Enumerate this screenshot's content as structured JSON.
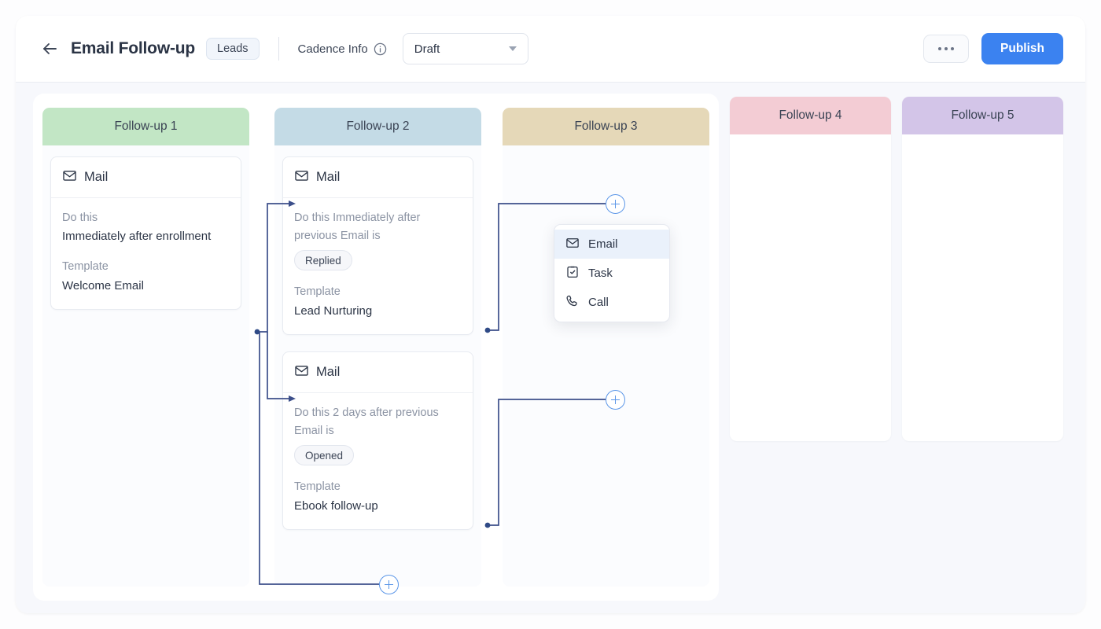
{
  "header": {
    "back_icon": "arrow-left-icon",
    "title": "Email Follow-up",
    "badge": "Leads",
    "cadence_label": "Cadence Info",
    "info_icon": "info-circle-icon",
    "status_value": "Draft",
    "status_options": [
      "Draft"
    ],
    "more_label": "...",
    "publish_label": "Publish"
  },
  "columns": [
    {
      "title": "Follow-up 1",
      "color": "#c2e6c5"
    },
    {
      "title": "Follow-up 2",
      "color": "#c4dbe6"
    },
    {
      "title": "Follow-up 3",
      "color": "#e5d8b8"
    },
    {
      "title": "Follow-up 4",
      "color": "#f3ccd4"
    },
    {
      "title": "Follow-up 5",
      "color": "#d3c5e8"
    }
  ],
  "cards": [
    {
      "type_icon": "mail-icon",
      "type_label": "Mail",
      "timing_label": "Do this",
      "timing_value": "Immediately after enrollment",
      "chip": "",
      "template_label": "Template",
      "template_value": "Welcome Email"
    },
    {
      "type_icon": "mail-icon",
      "type_label": "Mail",
      "timing_label": "Do this Immediately after previous Email is",
      "timing_value": "",
      "chip": "Replied",
      "template_label": "Template",
      "template_value": "Lead Nurturing"
    },
    {
      "type_icon": "mail-icon",
      "type_label": "Mail",
      "timing_label": "Do this 2 days after previous Email is",
      "timing_value": "",
      "chip": "Opened",
      "template_label": "Template",
      "template_value": "Ebook follow-up"
    }
  ],
  "dropdown": {
    "items": [
      {
        "label": "Email",
        "icon": "mail-icon",
        "active": true
      },
      {
        "label": "Task",
        "icon": "task-checklist-icon",
        "active": false
      },
      {
        "label": "Call",
        "icon": "phone-icon",
        "active": false
      }
    ]
  },
  "add_buttons": [
    {
      "name": "add-step-followup3-top"
    },
    {
      "name": "add-step-followup3-bottom"
    },
    {
      "name": "add-step-followup2-bottom"
    }
  ],
  "colors": {
    "accent": "#3b82f0",
    "wire": "#3c4f8a",
    "plus_border": "#5b96e8",
    "board_bg": "#f7f8fc"
  }
}
